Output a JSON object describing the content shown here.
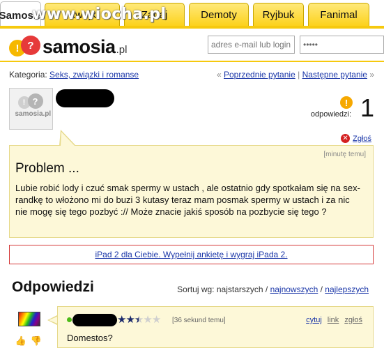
{
  "tabs": [
    {
      "label": "Samosia",
      "active": true
    },
    {
      "label": "Kwejk",
      "active": false
    },
    {
      "label": "Zadaj",
      "active": false
    },
    {
      "label": "Demoty",
      "active": false
    },
    {
      "label": "Ryjbuk",
      "active": false
    },
    {
      "label": "Fanimal",
      "active": false
    }
  ],
  "watermark": "www.wiocha.pl",
  "logo": {
    "name": "samosia",
    "tld": ".pl",
    "bubble_left": "!",
    "bubble_right": "?"
  },
  "login": {
    "email_placeholder": "adres e-mail lub login",
    "password_value": "•••••"
  },
  "category": {
    "label": "Kategoria:",
    "value": "Seks, związki i romanse"
  },
  "nav": {
    "prev": "Poprzednie pytanie",
    "next": "Następne pytanie",
    "sep": "|",
    "left_arrow": "«",
    "right_arrow": "»"
  },
  "asker": {
    "avatar_text": "samosia.pl"
  },
  "answers_count": {
    "label": "odpowiedzi:",
    "value": "1"
  },
  "report": {
    "label": "Zgłoś"
  },
  "question": {
    "time": "[minutę temu]",
    "title": "Problem ...",
    "body": "Lubie robić lody i czuć smak spermy w ustach , ale ostatnio gdy spotkałam się na sex-randkę to włożono mi do buzi 3 kutasy teraz mam posmak spermy w ustach i za nic nie mogę się tego pozbyć :// Może znacie jakiś sposób na pozbycie się tego ?"
  },
  "ad": {
    "text": "iPad 2 dla Ciebie. Wypełnij ankietę i wygraj iPada 2."
  },
  "answers_section": {
    "title": "Odpowiedzi",
    "sort_label": "Sortuj wg: najstarszych /",
    "sort_newest": "najnowszych",
    "sort_sep": "/",
    "sort_best": "najlepszych"
  },
  "answer": {
    "rating_stars": 2.5,
    "rating_max": 5,
    "time": "[36 sekund temu]",
    "actions": {
      "quote": "cytuj",
      "link": "link",
      "report": "zgłoś"
    },
    "text": "Domestos?"
  },
  "colors": {
    "tab_yellow": "#fcd21c",
    "link_blue": "#1a36a8",
    "note_bg": "#fdf8d8",
    "accent_red": "#d42020"
  }
}
